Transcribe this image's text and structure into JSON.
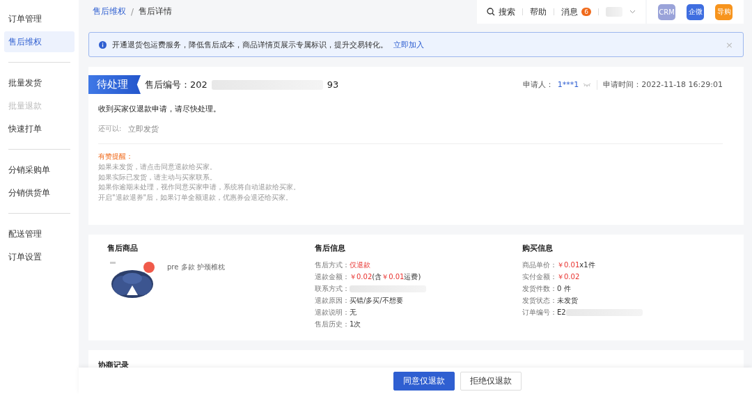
{
  "sidebar": {
    "groups": [
      {
        "items": [
          {
            "label": "订单管理",
            "selected": false,
            "disabled": false
          },
          {
            "label": "售后维权",
            "selected": true,
            "disabled": false
          }
        ]
      },
      {
        "items": [
          {
            "label": "批量发货",
            "selected": false,
            "disabled": false
          },
          {
            "label": "批量退款",
            "selected": false,
            "disabled": true
          },
          {
            "label": "快速打单",
            "selected": false,
            "disabled": false
          }
        ]
      },
      {
        "items": [
          {
            "label": "分销采购单",
            "selected": false,
            "disabled": false
          },
          {
            "label": "分销供货单",
            "selected": false,
            "disabled": false
          }
        ]
      },
      {
        "items": [
          {
            "label": "配送管理",
            "selected": false,
            "disabled": false
          },
          {
            "label": "订单设置",
            "selected": false,
            "disabled": false
          }
        ]
      }
    ]
  },
  "breadcrumb_separator": "/",
  "breadcrumb": [
    {
      "label": "售后维权",
      "selected": false
    },
    {
      "label": "售后详情",
      "selected": true
    }
  ],
  "header": {
    "search": "搜索",
    "help": "帮助",
    "messages": "消息",
    "message_count": "6",
    "apps": [
      {
        "label": "CRM",
        "color": "#9aa3d9"
      },
      {
        "label": "企微",
        "color": "#3f6ee0"
      },
      {
        "label": "导购",
        "color": "#f7941d"
      }
    ]
  },
  "notice": {
    "text": "开通退货包运费服务，降低售后成本，商品详情页展示专属标识，提升交易转化。",
    "link": "立即加入",
    "close": "×"
  },
  "case": {
    "status": "待处理",
    "number_label": "售后编号：",
    "number_start": "202",
    "number_end": "93",
    "applicant_label": "申请人：",
    "applicant": "1***1",
    "time_label": "申请时间：",
    "time": "2022-11-18 16:29:01",
    "message": "收到买家仅退款申请，请尽快处理。",
    "also_label": "还可以:",
    "also_action": "立即发货",
    "tips_title": "有赞提醒：",
    "tips": [
      "如果未发货，请点击同意退款给买家。",
      "如果实际已发货，请主动与买家联系。",
      "如果你逾期未处理，视作同意买家申请，系统将自动退款给买家。",
      "开启\"退款退券\"后，如果订单全额退款，优惠券会退还给买家。"
    ]
  },
  "product": {
    "title": "售后商品",
    "name": "pre 多款 护颈椎枕"
  },
  "aftersale": {
    "title": "售后信息",
    "rows": [
      {
        "label": "售后方式：",
        "parts": [
          {
            "text": "仅退款",
            "kind": "price"
          }
        ]
      },
      {
        "label": "退款金额：",
        "parts": [
          {
            "text": "￥0.02",
            "kind": "price"
          },
          {
            "text": " (含",
            "kind": "text"
          },
          {
            "text": "￥0.01",
            "kind": "price"
          },
          {
            "text": "运费)",
            "kind": "text"
          }
        ]
      },
      {
        "label": "联系方式：",
        "parts": [
          {
            "kind": "hidden"
          }
        ]
      },
      {
        "label": "退款原因：",
        "parts": [
          {
            "text": "买错/多买/不想要",
            "kind": "text"
          }
        ]
      },
      {
        "label": "退款说明：",
        "parts": [
          {
            "text": "无",
            "kind": "text"
          }
        ]
      },
      {
        "label": "售后历史：",
        "parts": [
          {
            "text": "1",
            "kind": "link"
          },
          {
            "text": "次",
            "kind": "text"
          }
        ]
      }
    ]
  },
  "purchase": {
    "title": "购买信息",
    "rows": [
      {
        "label": "商品单价：",
        "parts": [
          {
            "text": "￥0.01",
            "kind": "price"
          },
          {
            "text": " x1件",
            "kind": "text"
          }
        ]
      },
      {
        "label": "实付金额：",
        "parts": [
          {
            "text": "￥0.02",
            "kind": "price"
          }
        ]
      },
      {
        "label": "发货件数：",
        "parts": [
          {
            "text": "0 件",
            "kind": "text"
          }
        ]
      },
      {
        "label": "发货状态：",
        "parts": [
          {
            "text": "未发货",
            "kind": "text"
          }
        ]
      },
      {
        "label": "订单编号：",
        "parts": [
          {
            "text": "E2",
            "kind": "link"
          },
          {
            "kind": "hidden"
          }
        ]
      }
    ]
  },
  "negotiation": {
    "title": "协商记录"
  },
  "actions": [
    {
      "label": "同意仅退款",
      "kind": "primary"
    },
    {
      "label": "拒绝仅退款",
      "kind": "default"
    }
  ]
}
